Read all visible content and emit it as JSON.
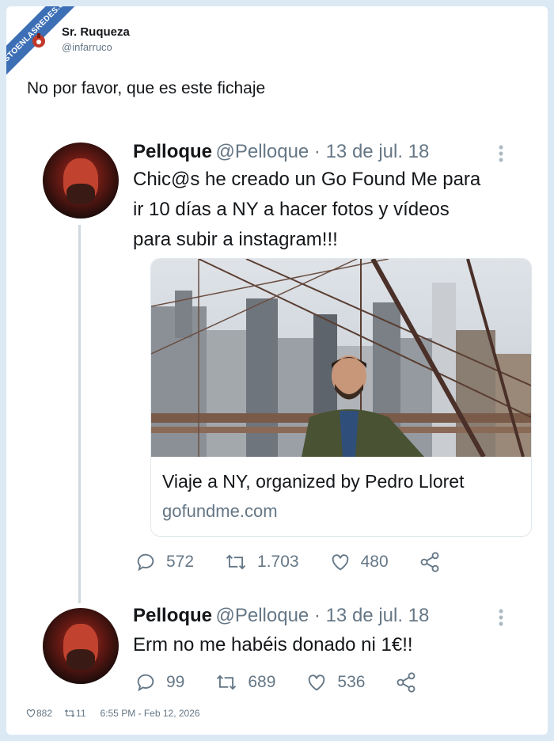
{
  "watermark": "VISTOENLASREDES.com",
  "author": {
    "name": "Sr. Ruqueza",
    "handle": "@infarruco"
  },
  "outer_text": "No por favor, que es este fichaje",
  "tweet1": {
    "name": "Pelloque",
    "meta": "@Pelloque · 13 de jul. 18",
    "lines": [
      "Chic@s he creado un Go Found Me para",
      "ir 10 días a NY a hacer fotos y vídeos",
      "para subir a instagram!!!"
    ],
    "card": {
      "title": "Viaje a NY, organized by Pedro Lloret",
      "domain": "gofundme.com"
    },
    "replies": "572",
    "retweets": "1.703",
    "likes": "480"
  },
  "tweet2": {
    "name": "Pelloque",
    "meta": "@Pelloque · 13 de jul. 18",
    "text": "Erm no me habéis donado ni 1€!!",
    "replies": "99",
    "retweets": "689",
    "likes": "536"
  },
  "footer": {
    "likes": "882",
    "retweets": "11",
    "timestamp": "6:55 PM - Feb 12, 2026"
  }
}
